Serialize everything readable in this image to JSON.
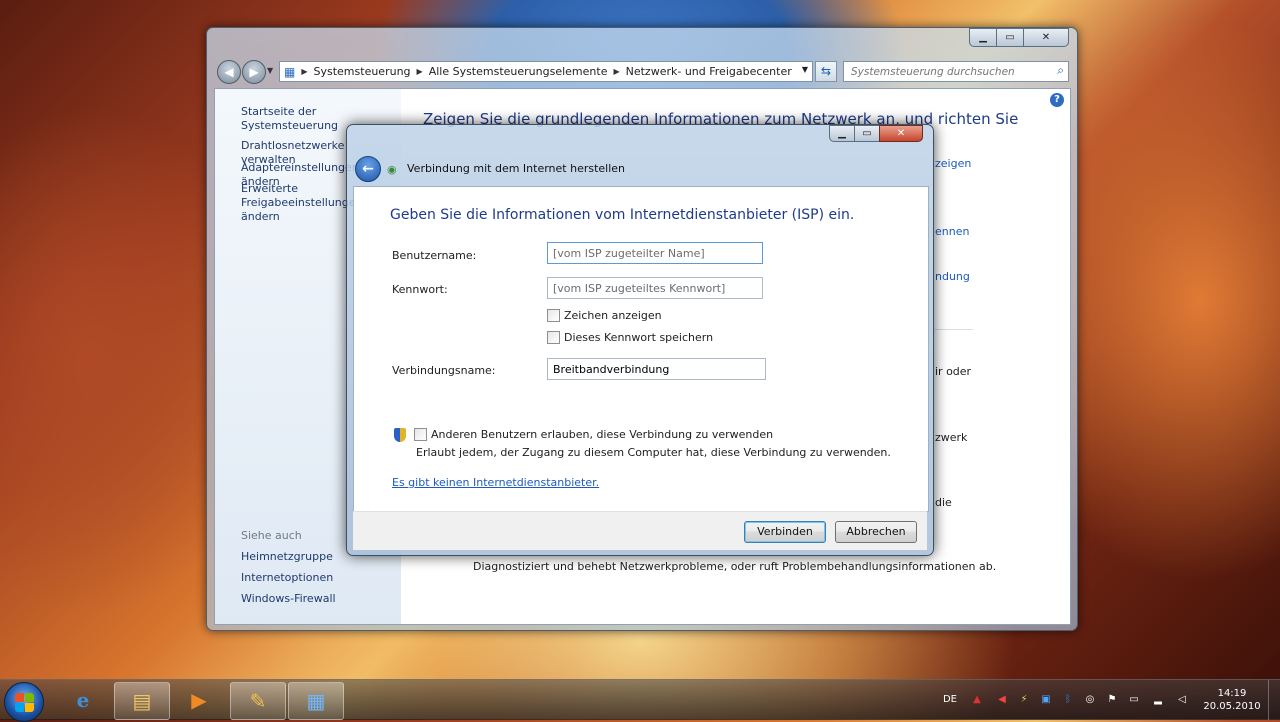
{
  "explorer": {
    "breadcrumb": [
      "Systemsteuerung",
      "Alle Systemsteuerungselemente",
      "Netzwerk- und Freigabecenter"
    ],
    "search_placeholder": "Systemsteuerung durchsuchen",
    "left_links": [
      "Startseite der Systemsteuerung",
      "Drahtlosnetzwerke verwalten",
      "Adaptereinstellungen ändern",
      "Erweiterte",
      "Freigabeeinstellungen ändern"
    ],
    "see_also": "Siehe auch",
    "see_also_links": [
      "Heimnetzgruppe",
      "Internetoptionen",
      "Windows-Firewall"
    ],
    "main_title": "Zeigen Sie die grundlegenden Informationen zum Netzwerk an, und richten Sie",
    "right_fragments": [
      "zeigen",
      "ennen",
      "ndung",
      "ir oder",
      "zwerk",
      "die"
    ],
    "diagnose_text": "Diagnostiziert und behebt Netzwerkprobleme, oder ruft Problembehandlungsinformationen ab."
  },
  "dialog": {
    "title": "Verbindung mit dem Internet herstellen",
    "instruction": "Geben Sie die Informationen vom Internetdienstanbieter (ISP) ein.",
    "username_label": "Benutzername:",
    "username_placeholder": "[vom ISP zugeteilter Name]",
    "password_label": "Kennwort:",
    "password_placeholder": "[vom ISP zugeteiltes Kennwort]",
    "show_chars": "Zeichen anzeigen",
    "save_password": "Dieses Kennwort speichern",
    "connection_name_label": "Verbindungsname:",
    "connection_name_value": "Breitbandverbindung",
    "allow_others": "Anderen Benutzern erlauben, diese Verbindung zu verwenden",
    "allow_others_sub": "Erlaubt jedem, der Zugang zu diesem Computer hat, diese Verbindung zu verwenden.",
    "no_isp_link": "Es gibt keinen Internetdienstanbieter.",
    "connect_button": "Verbinden",
    "cancel_button": "Abbrechen"
  },
  "taskbar": {
    "language": "DE",
    "time": "14:19",
    "date": "20.05.2010"
  }
}
